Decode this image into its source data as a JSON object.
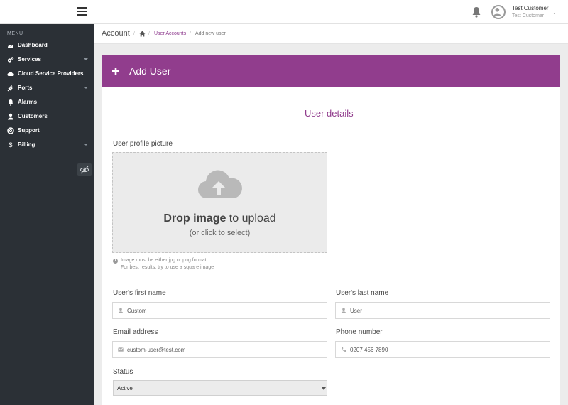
{
  "header": {
    "user_name": "Test Customer",
    "user_role": "Test Customer"
  },
  "sidebar": {
    "menu_heading": "MENU",
    "items": [
      {
        "label": "Dashboard",
        "icon": "dashboard-icon",
        "has_submenu": false
      },
      {
        "label": "Services",
        "icon": "cogs-icon",
        "has_submenu": true
      },
      {
        "label": "Cloud Service Providers",
        "icon": "cloud-icon",
        "has_submenu": false
      },
      {
        "label": "Ports",
        "icon": "plug-icon",
        "has_submenu": true
      },
      {
        "label": "Alarms",
        "icon": "bell-icon",
        "has_submenu": false
      },
      {
        "label": "Customers",
        "icon": "user-icon",
        "has_submenu": false
      },
      {
        "label": "Support",
        "icon": "life-ring-icon",
        "has_submenu": false
      },
      {
        "label": "Billing",
        "icon": "dollar-icon",
        "has_submenu": true
      }
    ]
  },
  "breadcrumb": {
    "title": "Account",
    "link": "User Accounts",
    "current": "Add new user"
  },
  "panel": {
    "title": "Add User",
    "section_title": "User details"
  },
  "form": {
    "profile_picture_label": "User profile picture",
    "drop_bold": "Drop image",
    "drop_rest": " to upload",
    "drop_sub": "(or click to select)",
    "hint_line1": "Image must be either jpg or png format.",
    "hint_line2": "For best results, try to use a square image",
    "first_name_label": "User's first name",
    "first_name_value": "Custom",
    "last_name_label": "User's last name",
    "last_name_value": "User",
    "email_label": "Email address",
    "email_value": "custom-user@test.com",
    "phone_label": "Phone number",
    "phone_value": "0207 456 7890",
    "status_label": "Status",
    "status_value": "Active"
  },
  "colors": {
    "brand": "#913d8d",
    "sidebar_bg": "#2b3036",
    "page_bg": "#ececec"
  }
}
